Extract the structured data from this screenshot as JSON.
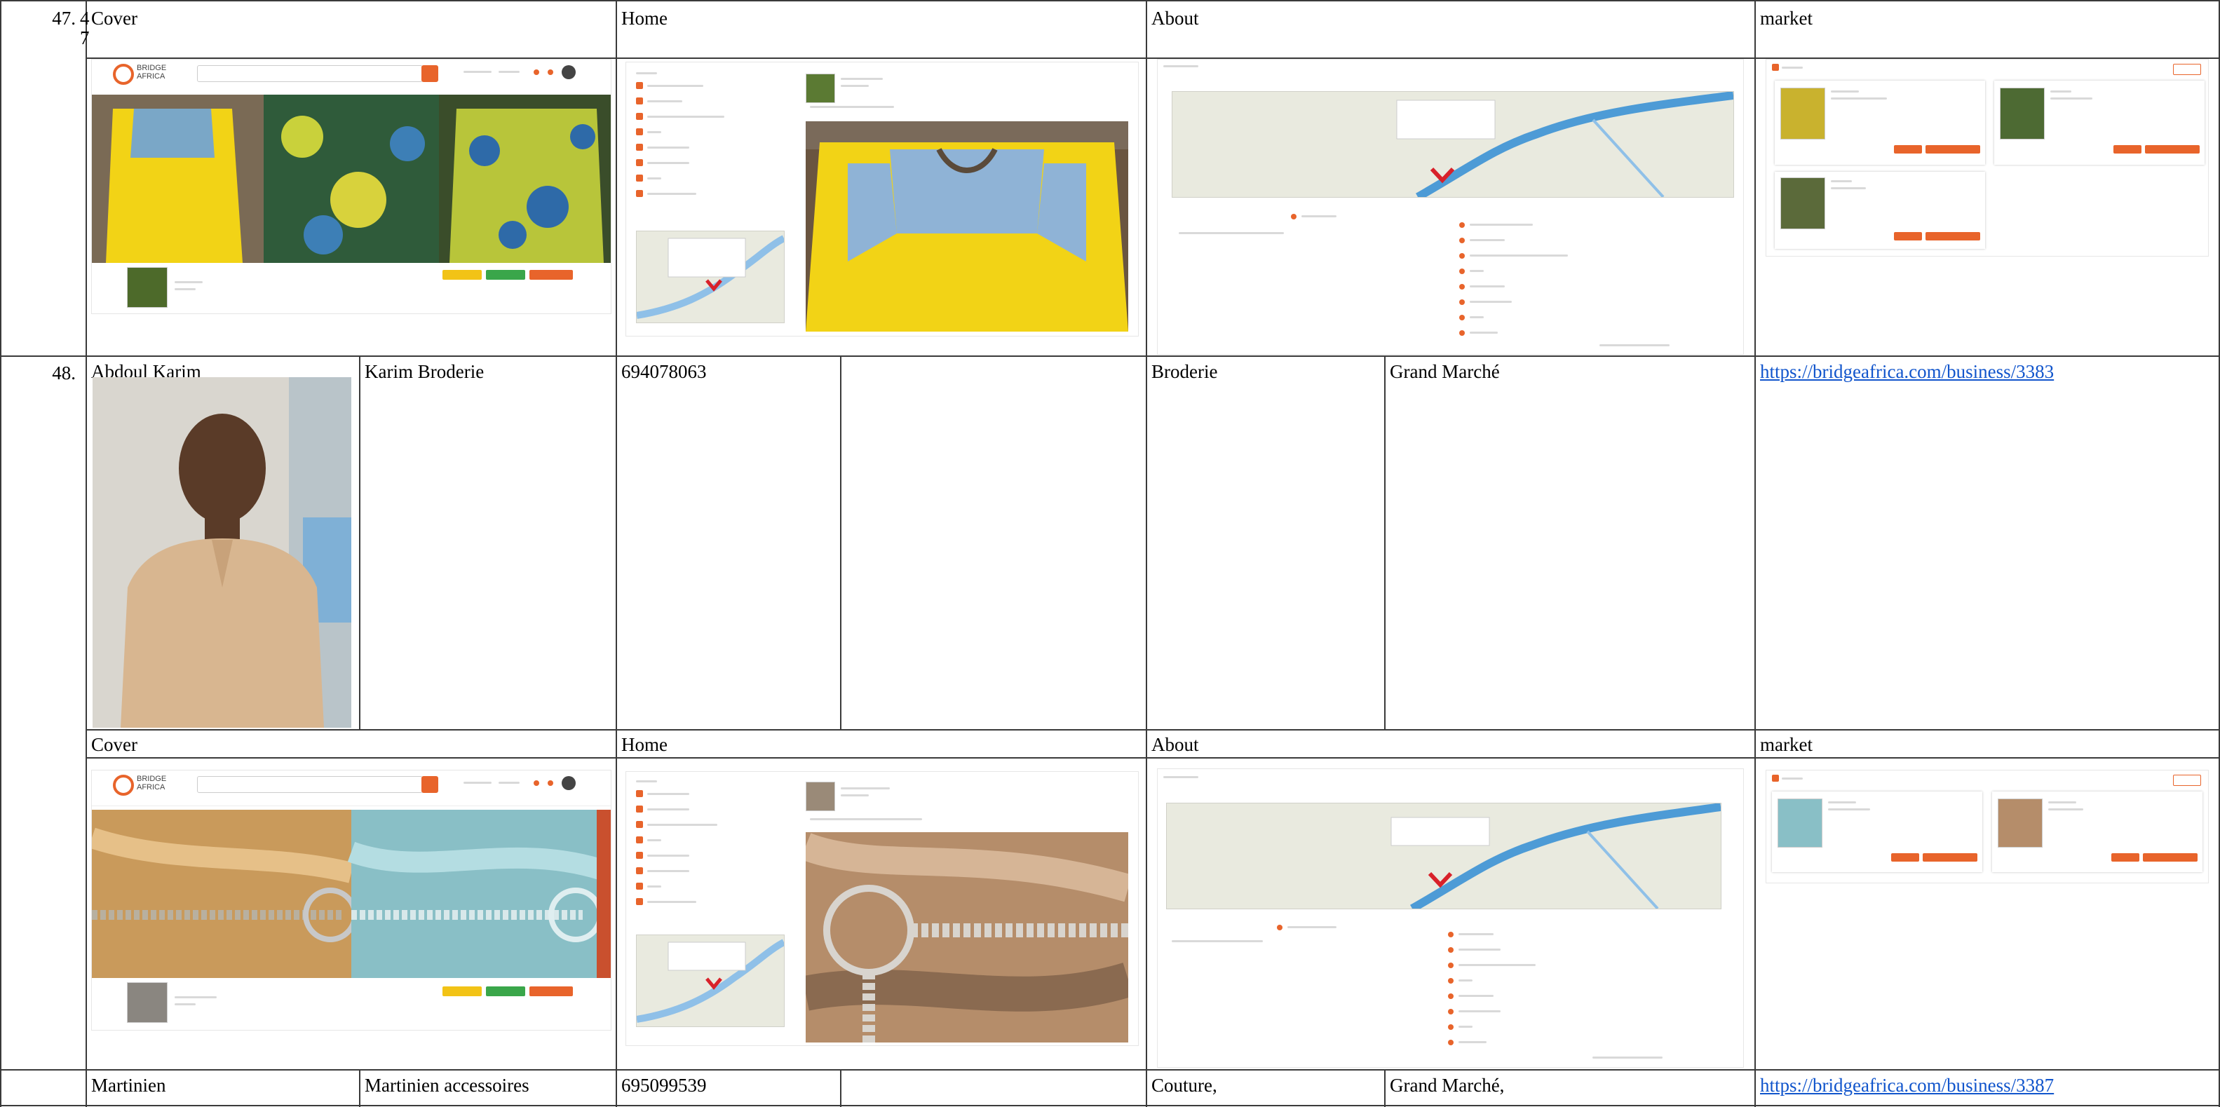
{
  "rows": [
    {
      "number": "47.",
      "number_overflow": "4",
      "number_overflow2": "7",
      "screens": {
        "cover_label": "Cover",
        "home_label": "Home",
        "about_label": "About",
        "market_label": "market"
      }
    },
    {
      "number": "48.",
      "contact_name": "Abdoul Karim",
      "business_name": "Karim Broderie",
      "phone": "694078063",
      "category": "Broderie",
      "location": "Grand Marché",
      "url": "https://bridgeafrica.com/business/3383",
      "screens": {
        "cover_label": "Cover",
        "home_label": "Home",
        "about_label": "About",
        "market_label": "market"
      }
    },
    {
      "number": "",
      "contact_name": "Martinien",
      "business_name": "Martinien accessoires",
      "phone": "695099539",
      "category": "Couture,",
      "location": "Grand Marché,",
      "url": "https://bridgeafrica.com/business/3387"
    }
  ],
  "icons": {
    "map_marker": "map-pin-icon",
    "search": "search-icon"
  },
  "colors": {
    "link": "#1155cc",
    "brand_orange": "#e8642b",
    "fabric_yellow": "#f2d316",
    "fabric_blue": "#7aa7c7",
    "satin_gold": "#c99a5b",
    "satin_blue": "#89bfc6"
  }
}
